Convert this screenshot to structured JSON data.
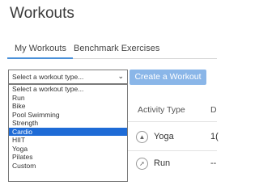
{
  "page": {
    "title": "Workouts"
  },
  "tabs": [
    {
      "label": "My Workouts",
      "active": true
    },
    {
      "label": "Benchmark Exercises",
      "active": false
    }
  ],
  "workout_type_select": {
    "selected_label": "Select a workout type...",
    "options": [
      "Select a workout type...",
      "Run",
      "Bike",
      "Pool Swimming",
      "Strength",
      "Cardio",
      "HIIT",
      "Yoga",
      "Pilates",
      "Custom"
    ],
    "highlighted_option": "Cardio"
  },
  "create_button": {
    "label": "Create a Workout"
  },
  "table": {
    "columns": [
      "Activity Type",
      "D"
    ],
    "rows": [
      {
        "activity": "Yoga",
        "icon": "yoga-icon",
        "value": "1("
      },
      {
        "activity": "Run",
        "icon": "run-icon",
        "value": "--"
      }
    ]
  },
  "colors": {
    "accent": "#4a90d9",
    "button": "#8ab6e8",
    "highlight": "#1e6bd6"
  }
}
